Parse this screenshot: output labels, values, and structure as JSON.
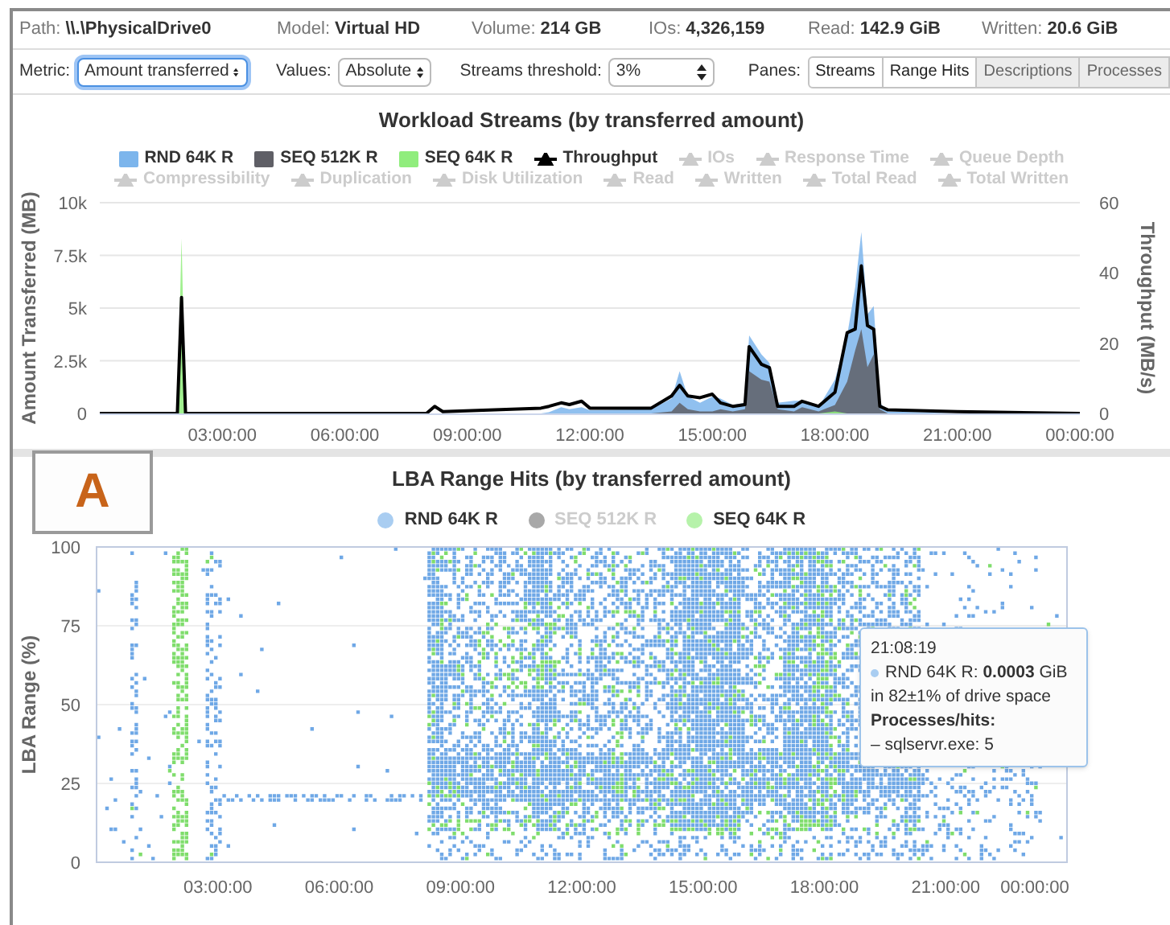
{
  "header": {
    "fields": [
      {
        "label": "Path:",
        "value": "\\\\.\\PhysicalDrive0"
      },
      {
        "label": "Model:",
        "value": "Virtual HD"
      },
      {
        "label": "Volume:",
        "value": "214 GB"
      },
      {
        "label": "IOs:",
        "value": "4,326,159"
      },
      {
        "label": "Read:",
        "value": "142.9 GiB"
      },
      {
        "label": "Written:",
        "value": "20.6 GiB"
      }
    ]
  },
  "toolbar": {
    "selects": [
      {
        "label": "Metric:",
        "value": "Amount transferred",
        "focused": true
      },
      {
        "label": "Values:",
        "value": "Absolute",
        "focused": false
      },
      {
        "label": "Streams threshold:",
        "value": "3%",
        "focused": false
      }
    ],
    "panes": {
      "label": "Panes:",
      "buttons": [
        {
          "label": "Streams",
          "selected": true
        },
        {
          "label": "Range Hits",
          "selected": true
        },
        {
          "label": "Descriptions",
          "selected": false
        },
        {
          "label": "Processes",
          "selected": false
        }
      ]
    }
  },
  "streams_chart": {
    "chart_data": {
      "type": "area",
      "title": "Workload Streams (by transferred amount)",
      "ylabel": "Amount Transferred (MB)",
      "stacked": false,
      "grid": true,
      "x": [
        0,
        1.9,
        2.0,
        2.1,
        2.3,
        8,
        8.2,
        8.4,
        10.8,
        11,
        11.3,
        11.5,
        11.8,
        12,
        13.5,
        14,
        14.2,
        14.4,
        14.7,
        15,
        15.2,
        15.5,
        15.8,
        15.9,
        16.2,
        16.4,
        16.6,
        17,
        17.2,
        17.6,
        18,
        18.3,
        18.5,
        18.65,
        18.8,
        18.95,
        19.1,
        19.3,
        21,
        24
      ],
      "xlim": [
        0,
        24
      ],
      "xticks": [
        {
          "value": 3,
          "label": "03:00:00"
        },
        {
          "value": 6,
          "label": "06:00:00"
        },
        {
          "value": 9,
          "label": "09:00:00"
        },
        {
          "value": 12,
          "label": "12:00:00"
        },
        {
          "value": 15,
          "label": "15:00:00"
        },
        {
          "value": 18,
          "label": "18:00:00"
        },
        {
          "value": 21,
          "label": "21:00:00"
        }
      ],
      "ylim": [
        0,
        10000
      ],
      "yticks": [
        {
          "value": 0,
          "label": "0"
        },
        {
          "value": 2500,
          "label": "2.5k"
        },
        {
          "value": 5000,
          "label": "5k"
        },
        {
          "value": 7500,
          "label": "7.5k"
        },
        {
          "value": 10000,
          "label": "10k"
        }
      ],
      "y2label": "Throughput (MB/s)",
      "y2lim": [
        0,
        60
      ],
      "y2ticks": [
        {
          "value": 0,
          "label": "0"
        },
        {
          "value": 20,
          "label": "20"
        },
        {
          "value": 40,
          "label": "40"
        },
        {
          "value": 60,
          "label": "60"
        }
      ],
      "series": [
        {
          "name": "RND 64K R",
          "type": "area",
          "color": "#7cb5ec",
          "values": [
            0,
            0,
            0,
            0,
            0,
            0,
            0,
            0,
            0,
            50,
            300,
            200,
            300,
            150,
            200,
            700,
            2000,
            800,
            500,
            800,
            700,
            400,
            500,
            3700,
            2800,
            2400,
            500,
            600,
            600,
            300,
            1600,
            3700,
            6000,
            8600,
            4700,
            5100,
            500,
            100,
            0,
            0
          ]
        },
        {
          "name": "SEQ 512K R",
          "type": "area",
          "color": "#5f5f66",
          "values": [
            0,
            0,
            0,
            0,
            0,
            0,
            0,
            0,
            0,
            0,
            0,
            0,
            0,
            0,
            0,
            100,
            500,
            200,
            100,
            100,
            200,
            100,
            200,
            2000,
            1600,
            1500,
            200,
            100,
            300,
            100,
            400,
            1500,
            3000,
            4000,
            2200,
            2800,
            200,
            0,
            0,
            0
          ]
        },
        {
          "name": "SEQ 64K R",
          "type": "area",
          "color": "#90ed7d",
          "values": [
            0,
            0,
            8300,
            0,
            0,
            0,
            0,
            0,
            0,
            0,
            0,
            0,
            0,
            0,
            0,
            0,
            0,
            0,
            0,
            0,
            0,
            0,
            0,
            0,
            0,
            0,
            0,
            0,
            0,
            0,
            100,
            0,
            0,
            0,
            0,
            0,
            0,
            0,
            0,
            0
          ]
        },
        {
          "name": "Throughput",
          "type": "line",
          "axis": "y2",
          "color": "#000000",
          "values": [
            0,
            0,
            33,
            0,
            0,
            0,
            2,
            0.5,
            1.5,
            2,
            3,
            2.5,
            3.5,
            1.5,
            1.5,
            5,
            8,
            5,
            4.5,
            5.5,
            3,
            2,
            2.5,
            19,
            14,
            13,
            2,
            2,
            3.5,
            2,
            6,
            23,
            24,
            42,
            25,
            24,
            2,
            1,
            0.5,
            0
          ]
        }
      ]
    },
    "axis_end_label": "00:00:00",
    "more_legend_rows": [
      [
        {
          "label": "IOs",
          "visible": false
        },
        {
          "label": "Response Time",
          "visible": false
        },
        {
          "label": "Queue Depth",
          "visible": false
        }
      ],
      [
        {
          "label": "Compressibility",
          "visible": false
        },
        {
          "label": "Duplication",
          "visible": false
        },
        {
          "label": "Disk Utilization",
          "visible": false
        },
        {
          "label": "Read",
          "visible": false
        },
        {
          "label": "Written",
          "visible": false
        },
        {
          "label": "Total Read",
          "visible": false
        },
        {
          "label": "Total Written",
          "visible": false
        }
      ]
    ]
  },
  "range_chart": {
    "title": "LBA Range Hits (by transferred amount)",
    "legend": [
      {
        "label": "RND 64K R",
        "visible": true,
        "color": "#a9cdf1"
      },
      {
        "label": "SEQ 512K R",
        "visible": false,
        "color": "#a8a8a8"
      },
      {
        "label": "SEQ 64K R",
        "visible": true,
        "color": "#b6f2aa"
      }
    ],
    "ylabel": "LBA Range (%)",
    "yticks": [
      "100",
      "75",
      "50",
      "25",
      "0"
    ],
    "xticks": [
      "03:00:00",
      "06:00:00",
      "09:00:00",
      "12:00:00",
      "15:00:00",
      "18:00:00",
      "21:00:00",
      "00:00:00"
    ],
    "tooltip": {
      "time": "21:08:19",
      "series_line": "RND 64K R: **0.0003** GiB",
      "range_line": "in 82±1% of drive space",
      "processes_heading": "Processes/hits:",
      "process_lines": [
        "– sqlservr.exe: 5"
      ]
    }
  },
  "annotation_badge": {
    "text": "A"
  }
}
